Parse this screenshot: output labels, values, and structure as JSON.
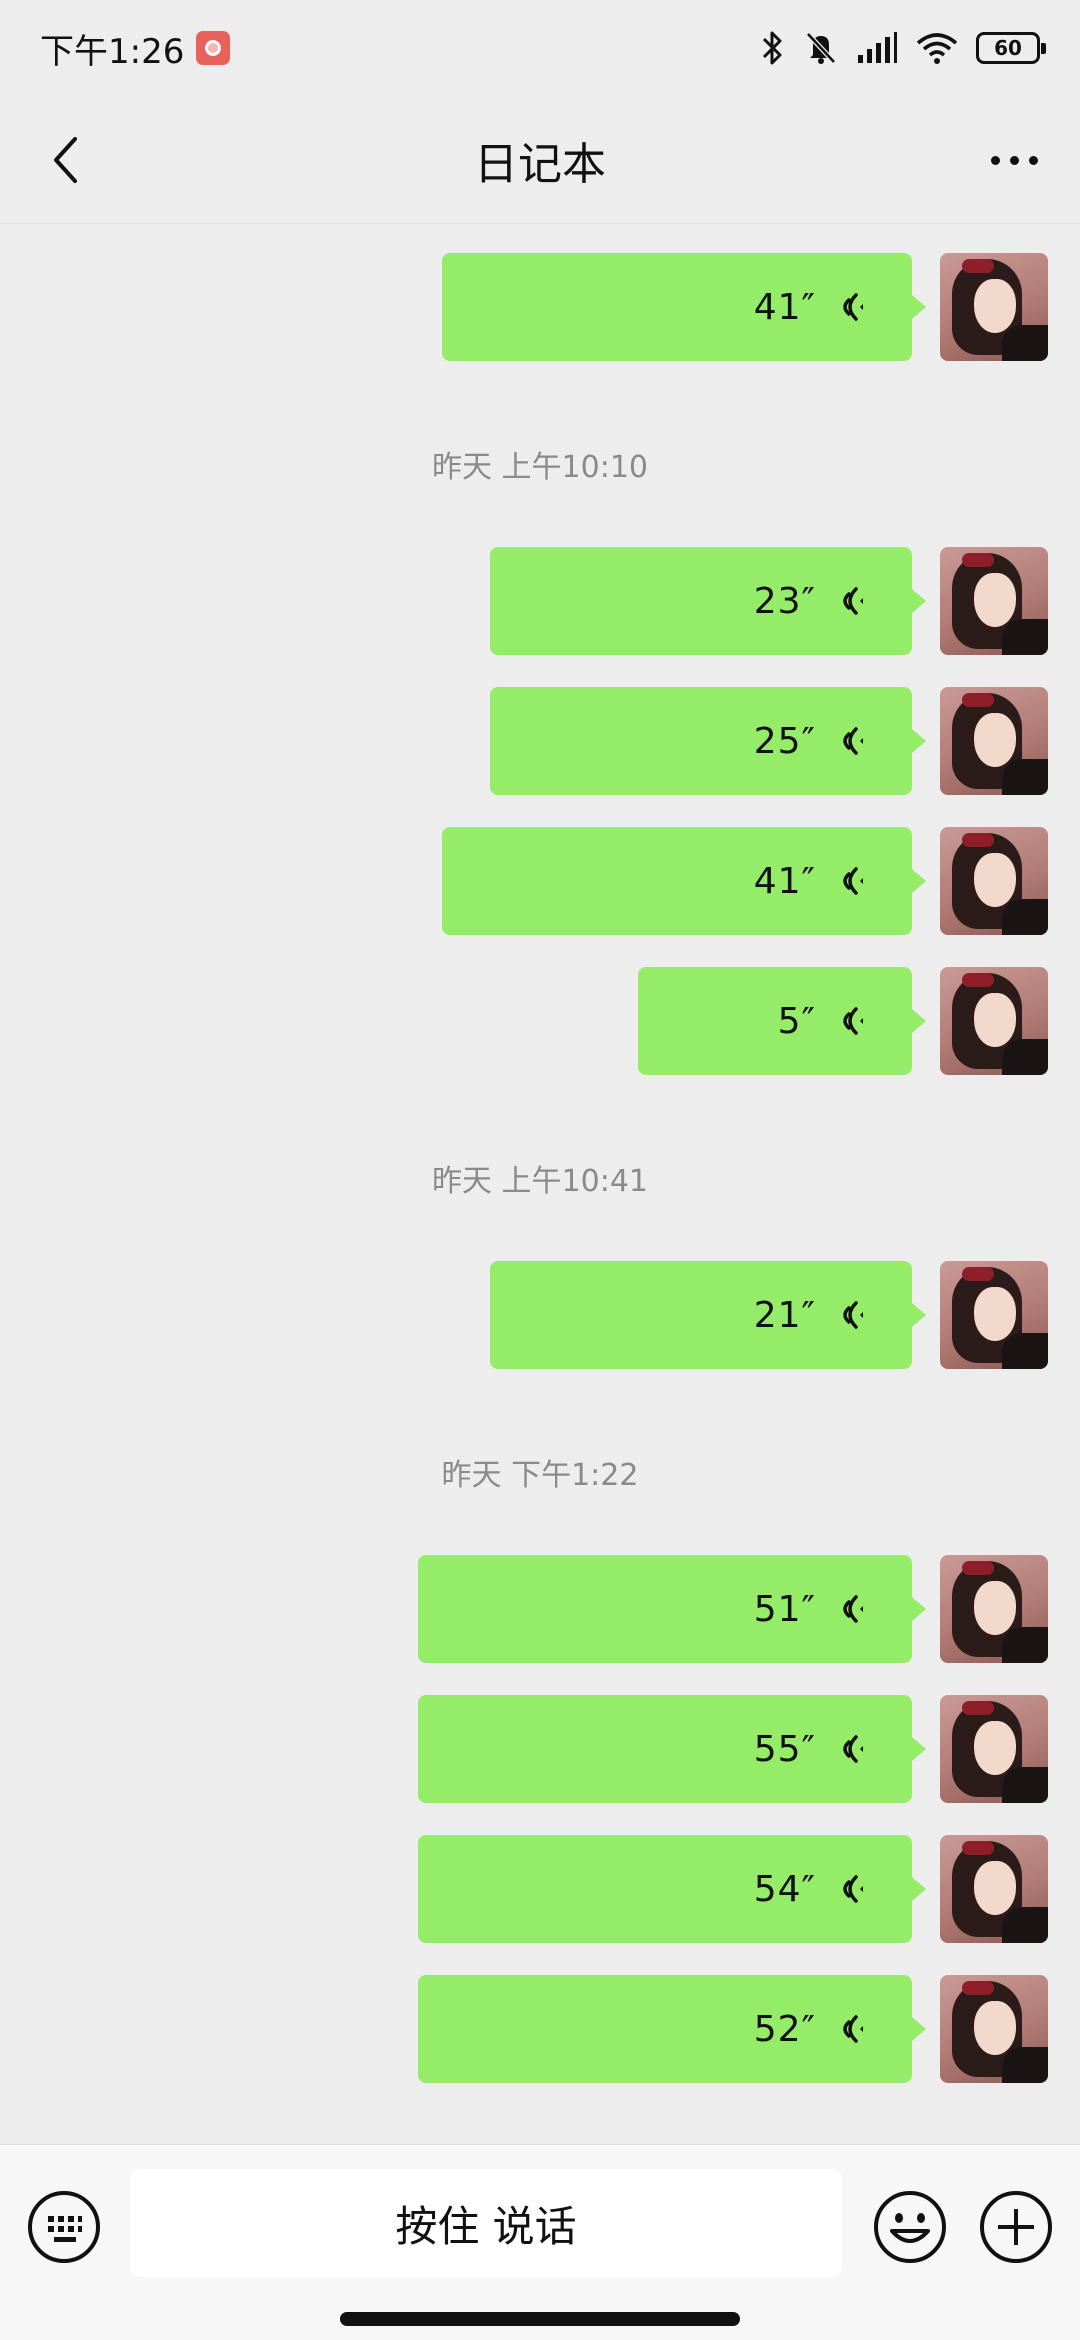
{
  "status_bar": {
    "time": "下午1:26",
    "battery": "60",
    "icons": [
      "recording-icon",
      "bluetooth-icon",
      "mute-bell-icon",
      "signal-icon",
      "wifi-icon",
      "battery-icon"
    ]
  },
  "header": {
    "title": "日记本",
    "back_icon": "chevron-left-icon",
    "more_icon": "more-dots-icon"
  },
  "timestamps": [
    "昨天 上午10:10",
    "昨天 上午10:41",
    "昨天 下午1:22"
  ],
  "messages": [
    {
      "duration": "41″"
    },
    {
      "duration": "23″"
    },
    {
      "duration": "25″"
    },
    {
      "duration": "41″"
    },
    {
      "duration": "5″"
    },
    {
      "duration": "21″"
    },
    {
      "duration": "51″"
    },
    {
      "duration": "55″"
    },
    {
      "duration": "54″"
    },
    {
      "duration": "52″"
    }
  ],
  "input_bar": {
    "talk_label": "按住 说话",
    "keyboard_icon": "keyboard-icon",
    "emoji_icon": "emoji-icon",
    "plus_icon": "plus-icon"
  },
  "colors": {
    "background": "#ededed",
    "bubble": "#95ec69",
    "timestamp_text": "#8a8a8a"
  }
}
